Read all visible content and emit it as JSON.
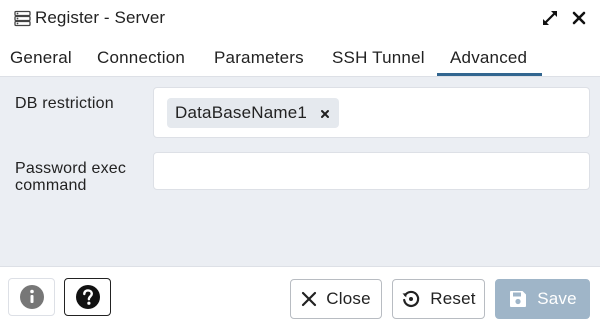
{
  "window": {
    "title": "Register - Server",
    "title_icon": "server-icon",
    "expand_icon": "expand-icon",
    "close_icon": "close-icon"
  },
  "tabs": [
    {
      "label": "General",
      "active": false
    },
    {
      "label": "Connection",
      "active": false
    },
    {
      "label": "Parameters",
      "active": false
    },
    {
      "label": "SSH Tunnel",
      "active": false
    },
    {
      "label": "Advanced",
      "active": true
    }
  ],
  "form": {
    "db_restriction": {
      "label": "DB restriction",
      "chips": [
        "DataBaseName1"
      ]
    },
    "password_exec_command": {
      "label": "Password exec command",
      "value": ""
    }
  },
  "footer": {
    "info_icon": "info-icon",
    "help_icon": "help-icon",
    "close_label": "Close",
    "reset_label": "Reset",
    "save_label": "Save",
    "save_enabled": false
  },
  "colors": {
    "accent": "#326690",
    "panel_bg": "#ebeef3",
    "save_disabled": "#9fb5c8",
    "border": "#dde0e6"
  }
}
